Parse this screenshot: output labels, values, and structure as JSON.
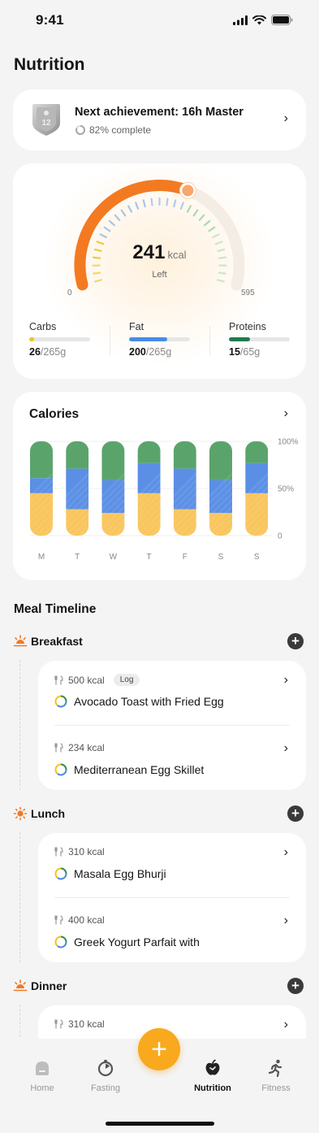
{
  "status_bar": {
    "time": "9:41"
  },
  "page": {
    "title": "Nutrition"
  },
  "achievement": {
    "badge_text": "12",
    "title": "Next achievement: 16h Master",
    "progress_text": "82% complete",
    "progress": 0.82
  },
  "calorie_gauge": {
    "value": "241",
    "unit": "kcal",
    "label": "Left",
    "min": "0",
    "max": "595",
    "fraction": 0.6,
    "accent": "#f37a21"
  },
  "macros": [
    {
      "name": "Carbs",
      "consumed": "26",
      "total": "/265g",
      "fill": 0.08,
      "color": "#f2c318"
    },
    {
      "name": "Fat",
      "consumed": "200",
      "total": "/265g",
      "fill": 0.63,
      "color": "#4a8ae8"
    },
    {
      "name": "Proteins",
      "consumed": "15",
      "total": "/65g",
      "fill": 0.35,
      "color": "#1f7a4d"
    }
  ],
  "calories_card": {
    "title": "Calories"
  },
  "chart_data": {
    "type": "bar",
    "stacked": true,
    "categories": [
      "M",
      "T",
      "W",
      "T",
      "F",
      "S",
      "S"
    ],
    "series": [
      {
        "values": [
          45,
          28,
          24,
          45,
          28,
          24,
          45
        ],
        "color": "#f9c55c"
      },
      {
        "values": [
          16,
          43,
          35,
          32,
          43,
          35,
          32
        ],
        "color": "#5b8fe5"
      },
      {
        "values": [
          39,
          29,
          41,
          23,
          29,
          41,
          23
        ],
        "color": "#5aa46c"
      }
    ],
    "y_ticks": [
      "100%",
      "50%",
      "0"
    ],
    "ylim": [
      0,
      100
    ]
  },
  "timeline": {
    "title": "Meal Timeline",
    "meals": [
      {
        "name": "Breakfast",
        "icon": "sunrise-icon",
        "items": [
          {
            "kcal": "500 kcal",
            "tag": "Log",
            "name": "Avocado Toast with Fried Egg"
          },
          {
            "kcal": "234 kcal",
            "tag": "",
            "name": "Mediterranean Egg Skillet"
          }
        ]
      },
      {
        "name": "Lunch",
        "icon": "sun-icon",
        "items": [
          {
            "kcal": "310 kcal",
            "tag": "",
            "name": "Masala Egg Bhurji"
          },
          {
            "kcal": "400 kcal",
            "tag": "",
            "name": "Greek Yogurt Parfait with"
          }
        ]
      },
      {
        "name": "Dinner",
        "icon": "sunset-icon",
        "items": [
          {
            "kcal": "310 kcal",
            "tag": "",
            "name": ""
          }
        ]
      }
    ]
  },
  "tabbar": {
    "fab_label": "+",
    "tabs": [
      {
        "label": "Home",
        "icon": "home-icon"
      },
      {
        "label": "Fasting",
        "icon": "timer-icon"
      },
      {
        "label": "Nutrition",
        "icon": "apple-icon",
        "active": true
      },
      {
        "label": "Fitness",
        "icon": "runner-icon"
      }
    ]
  }
}
